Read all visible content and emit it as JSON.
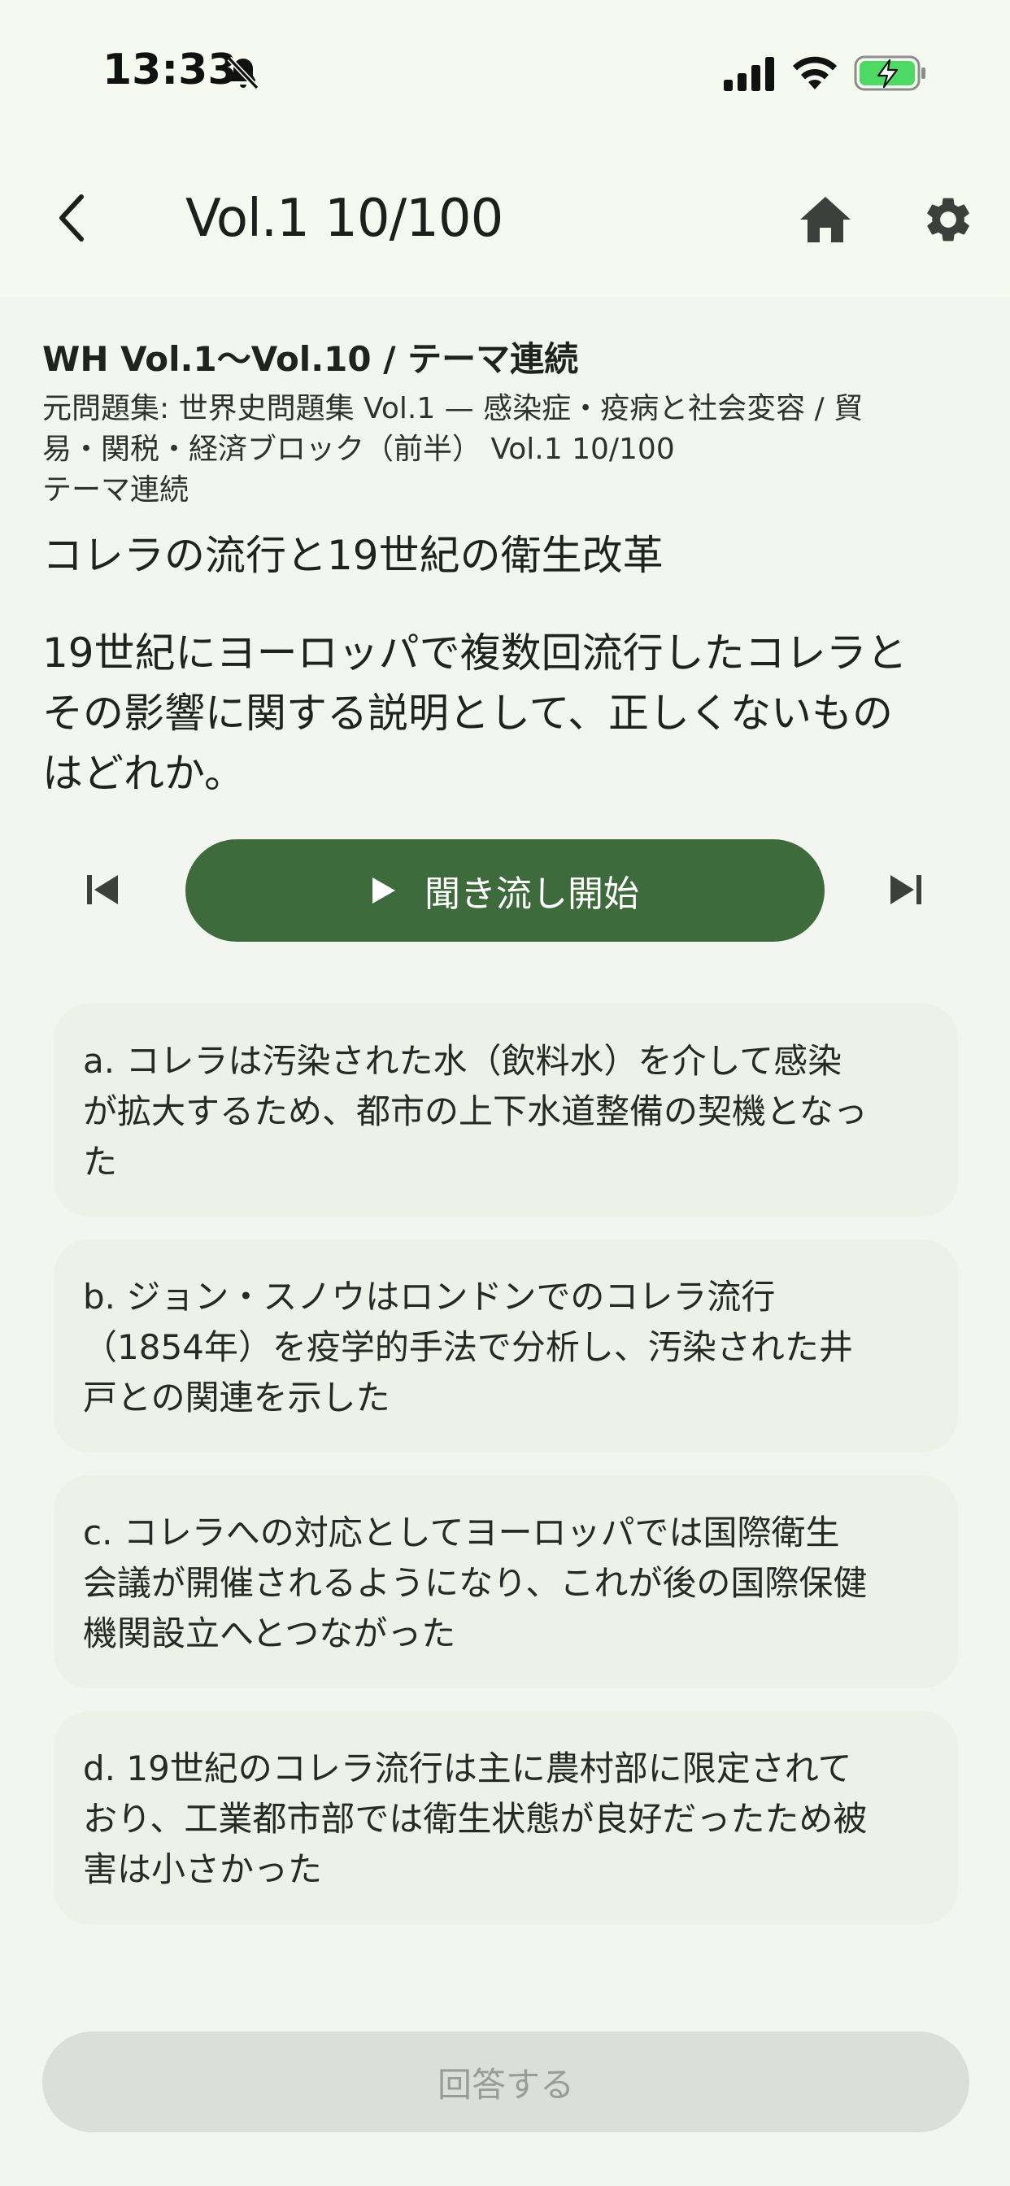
{
  "status_bar": {
    "time": "13:33"
  },
  "nav": {
    "title": "Vol.1 10/100"
  },
  "header": {
    "set_title": "WH Vol.1〜Vol.10 / テーマ連続",
    "source_line_1": "元問題集: 世界史問題集 Vol.1 — 感染症・疫病と社会変容 / 貿",
    "source_line_2": "易・関税・経済ブロック（前半） Vol.1 10/100",
    "mode": "テーマ連続"
  },
  "question": {
    "heading": "コレラの流行と19世紀の衛生改革",
    "line_1": "19世紀にヨーロッパで複数回流行したコレラと",
    "line_2": "その影響に関する説明として、正しくないもの",
    "line_3": "はどれか。"
  },
  "player": {
    "play_label": "聞き流し開始"
  },
  "choices": [
    {
      "line_1": "a. コレラは汚染された水（飲料水）を介して感染",
      "line_2": "が拡大するため、都市の上下水道整備の契機となっ",
      "line_3": "た"
    },
    {
      "line_1": "b. ジョン・スノウはロンドンでのコレラ流行",
      "line_2": "（1854年）を疫学的手法で分析し、汚染された井",
      "line_3": "戸との関連を示した"
    },
    {
      "line_1": "c. コレラへの対応としてヨーロッパでは国際衛生",
      "line_2": "会議が開催されるようになり、これが後の国際保健",
      "line_3": "機関設立へとつながった"
    },
    {
      "line_1": "d. 19世紀のコレラ流行は主に農村部に限定されて",
      "line_2": "おり、工業都市部では衛生状態が良好だったため被",
      "line_3": "害は小さかった"
    }
  ],
  "submit": {
    "label": "回答する"
  },
  "colors": {
    "accent": "#3e6b3c",
    "background": "#f3f5f0",
    "choice_background": "#edf1e7",
    "disabled_button": "#dcdedb",
    "battery_green": "#4cd964"
  },
  "icons": {
    "bell": "bell-slash-icon",
    "signal": "cellular-signal-icon",
    "wifi": "wifi-icon",
    "battery": "battery-charging-icon",
    "back": "chevron-left-icon",
    "home": "home-icon",
    "settings": "gear-icon",
    "prev": "skip-previous-icon",
    "play": "play-icon",
    "next": "skip-next-icon"
  }
}
